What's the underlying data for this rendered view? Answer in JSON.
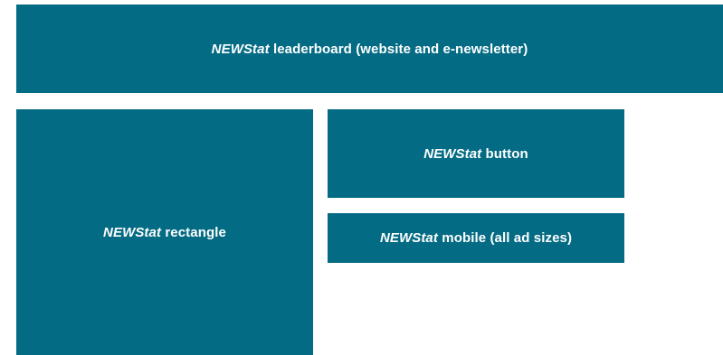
{
  "ad_units": {
    "leaderboard": {
      "brand": "NEWStat",
      "label": " leaderboard (website and e-newsletter)"
    },
    "rectangle": {
      "brand": "NEWStat",
      "label": " rectangle"
    },
    "button": {
      "brand": "NEWStat",
      "label": " button"
    },
    "mobile": {
      "brand": "NEWStat",
      "label": " mobile (all ad sizes)"
    }
  },
  "colors": {
    "box_background": "#036b84",
    "text": "#ffffff"
  }
}
